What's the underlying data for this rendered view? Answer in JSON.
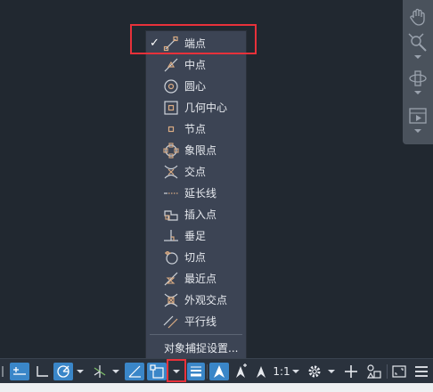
{
  "colors": {
    "background": "#212830",
    "menu_bg": "#3c4454",
    "icon_accent": "#d9ab83",
    "highlight_red": "#e8313a",
    "active_blue": "#3a86c8"
  },
  "navbar": {
    "icons": [
      "pan-hand-icon",
      "zoom-icon",
      "orbit-icon",
      "showmotion-icon"
    ]
  },
  "snap_menu": {
    "items": [
      {
        "label": "端点",
        "icon": "endpoint-icon",
        "checked": true
      },
      {
        "label": "中点",
        "icon": "midpoint-icon",
        "checked": false
      },
      {
        "label": "圆心",
        "icon": "center-icon",
        "checked": false
      },
      {
        "label": "几何中心",
        "icon": "geometric-center-icon",
        "checked": false
      },
      {
        "label": "节点",
        "icon": "node-icon",
        "checked": false
      },
      {
        "label": "象限点",
        "icon": "quadrant-icon",
        "checked": false
      },
      {
        "label": "交点",
        "icon": "intersection-icon",
        "checked": false
      },
      {
        "label": "延长线",
        "icon": "extension-icon",
        "checked": false
      },
      {
        "label": "插入点",
        "icon": "insertion-icon",
        "checked": false
      },
      {
        "label": "垂足",
        "icon": "perpendicular-icon",
        "checked": false
      },
      {
        "label": "切点",
        "icon": "tangent-icon",
        "checked": false
      },
      {
        "label": "最近点",
        "icon": "nearest-icon",
        "checked": false
      },
      {
        "label": "外观交点",
        "icon": "apparent-intersection-icon",
        "checked": false
      },
      {
        "label": "平行线",
        "icon": "parallel-icon",
        "checked": false
      }
    ],
    "check_mark": "✓",
    "settings_label": "对象捕捉设置..."
  },
  "statusbar": {
    "scale_label": "1:1"
  }
}
